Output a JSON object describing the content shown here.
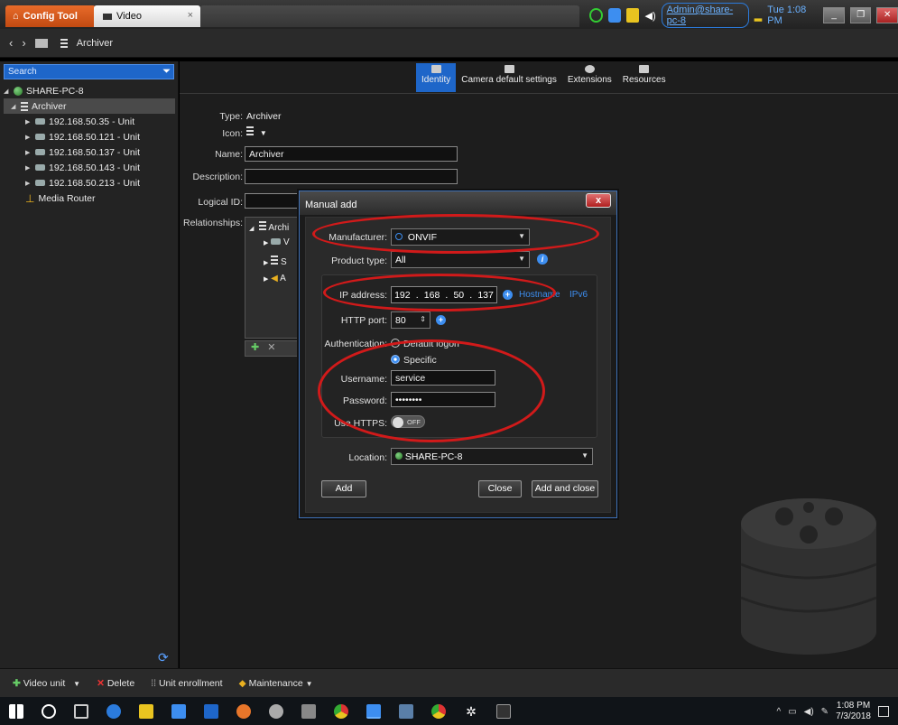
{
  "window": {
    "tab_config_tool": "Config Tool",
    "tab_video": "Video",
    "user_link": "Admin@share-pc-8",
    "clock": "Tue 1:08 PM"
  },
  "nav": {
    "breadcrumb": "Archiver"
  },
  "sidebar": {
    "search_placeholder": "Search",
    "items": [
      {
        "label": "SHARE-PC-8"
      },
      {
        "label": "Archiver"
      },
      {
        "label": "192.168.50.35 - Unit"
      },
      {
        "label": "192.168.50.121 - Unit"
      },
      {
        "label": "192.168.50.137 - Unit"
      },
      {
        "label": "192.168.50.143 - Unit"
      },
      {
        "label": "192.168.50.213 - Unit"
      },
      {
        "label": "Media Router"
      }
    ]
  },
  "config_tabs": [
    {
      "label": "Identity"
    },
    {
      "label": "Camera default settings"
    },
    {
      "label": "Extensions"
    },
    {
      "label": "Resources"
    }
  ],
  "identity": {
    "type_label": "Type:",
    "type_value": "Archiver",
    "icon_label": "Icon:",
    "name_label": "Name:",
    "name_value": "Archiver",
    "description_label": "Description:",
    "logical_id_label": "Logical ID:",
    "relationships_label": "Relationships:",
    "rel_root": "Archi",
    "rel_items": [
      "V",
      "S",
      "A"
    ]
  },
  "dialog": {
    "title": "Manual add",
    "close": "x",
    "manufacturer_label": "Manufacturer:",
    "manufacturer_value": "ONVIF",
    "product_type_label": "Product type:",
    "product_type_value": "All",
    "ip_label": "IP address:",
    "ip_octets": [
      "192",
      "168",
      "50",
      "137"
    ],
    "hostname_link": "Hostname",
    "ipv6_link": "IPv6",
    "http_port_label": "HTTP port:",
    "http_port_value": "80",
    "auth_label": "Authentication:",
    "auth_default": "Default logon",
    "auth_specific": "Specific",
    "username_label": "Username:",
    "username_value": "service",
    "password_label": "Password:",
    "password_value": "••••••••",
    "https_label": "Use HTTPS:",
    "https_state": "OFF",
    "location_label": "Location:",
    "location_value": "SHARE-PC-8",
    "btn_add": "Add",
    "btn_close": "Close",
    "btn_add_close": "Add and close"
  },
  "bottom_toolbar": {
    "video_unit": "Video unit",
    "delete": "Delete",
    "unit_enrollment": "Unit enrollment",
    "maintenance": "Maintenance"
  },
  "taskbar": {
    "time": "1:08 PM",
    "date": "7/3/2018"
  },
  "colors": {
    "accent_blue": "#1e66c9",
    "orange_tab": "#e86b2a",
    "annotation_red": "#d11a1a",
    "link_blue": "#3d8ef0"
  }
}
